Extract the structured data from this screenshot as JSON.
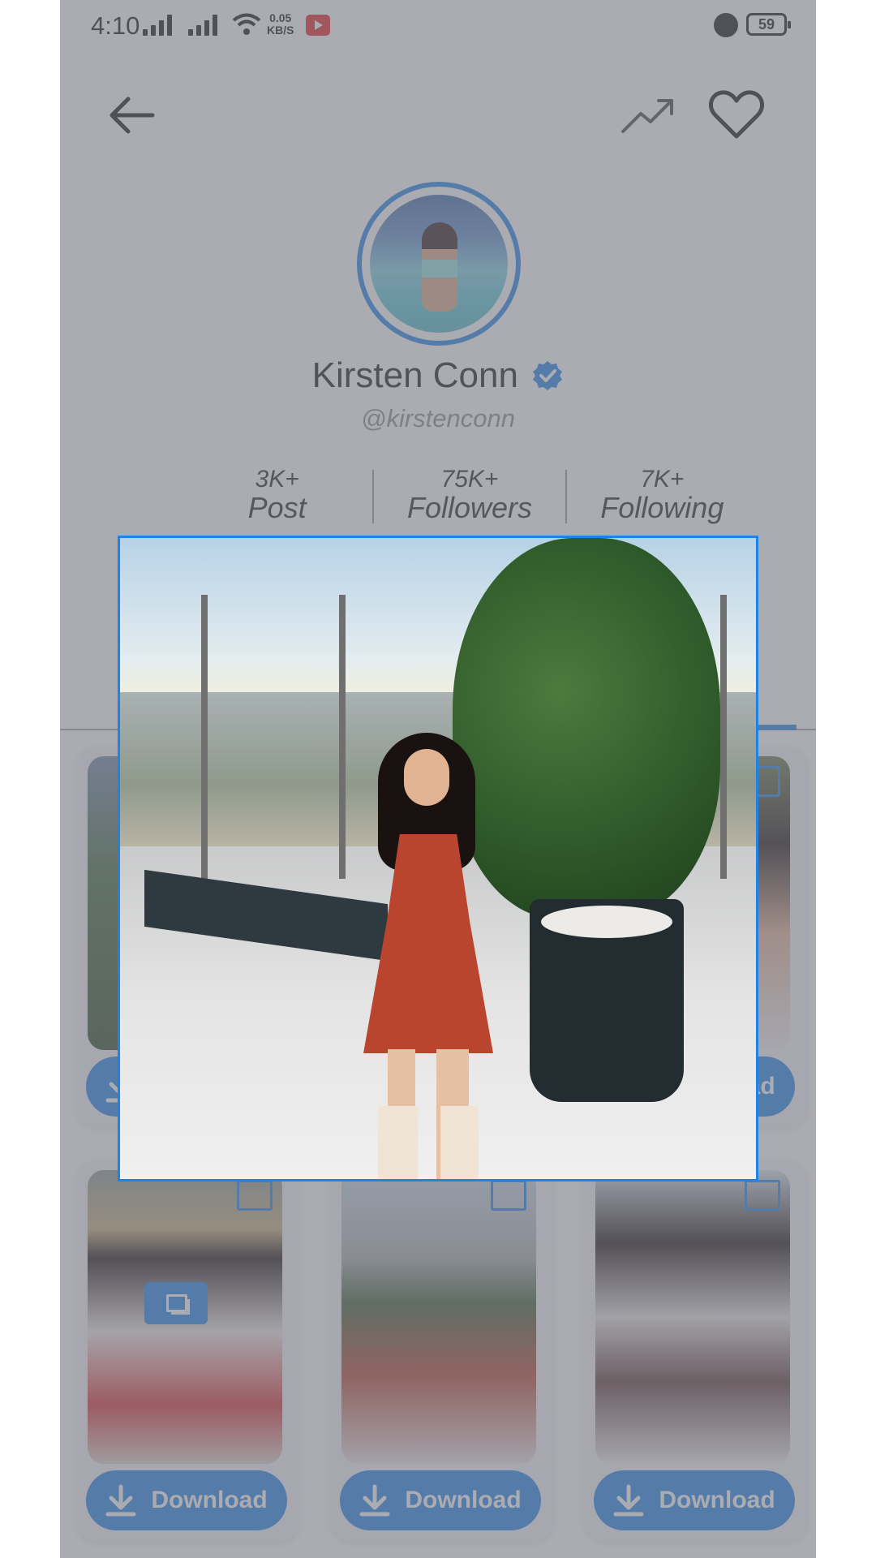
{
  "status_bar": {
    "time": "4:10",
    "net_speed_value": "0.05",
    "net_speed_unit": "KB/S",
    "battery": "59"
  },
  "profile": {
    "name": "Kirsten Conn",
    "handle": "@kirstenconn",
    "stats": [
      {
        "value": "3K+",
        "label": "Post"
      },
      {
        "value": "75K+",
        "label": "Followers"
      },
      {
        "value": "7K+",
        "label": "Following"
      }
    ]
  },
  "grid": {
    "download_label": "Download"
  },
  "colors": {
    "accent": "#1e82e6",
    "overlay": "#787882"
  },
  "icons": [
    "back-arrow-icon",
    "trending-icon",
    "heart-icon",
    "verified-badge-icon",
    "download-icon",
    "multi-image-icon",
    "youtube-icon",
    "alarm-icon",
    "battery-icon",
    "wifi-icon",
    "signal-icon"
  ]
}
